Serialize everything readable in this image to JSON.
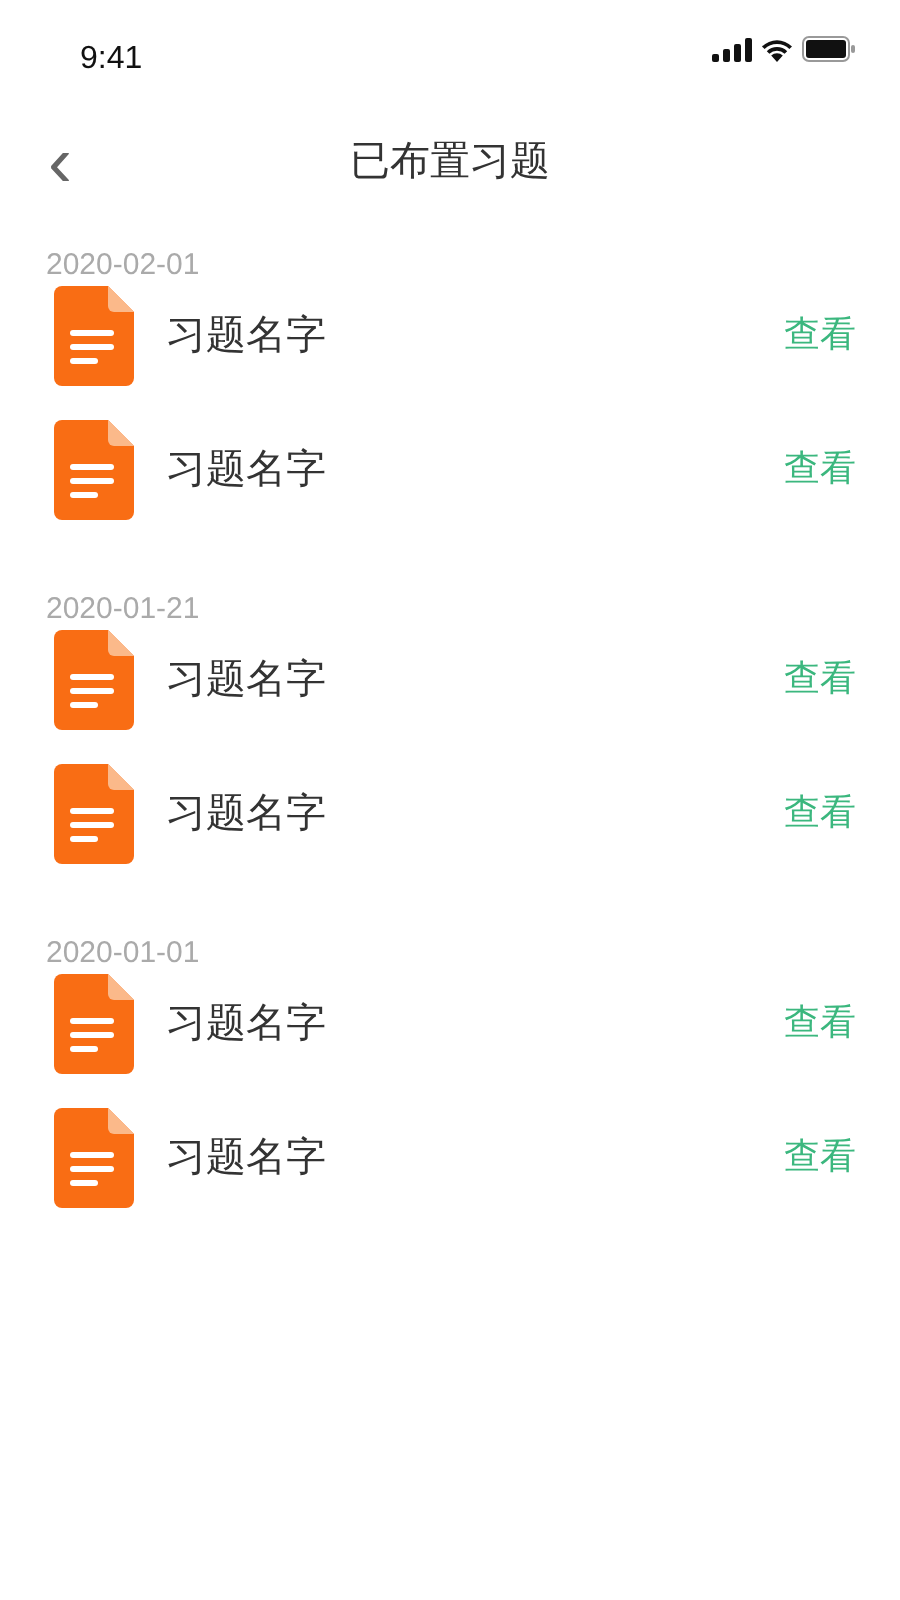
{
  "status_bar": {
    "time": "9:41"
  },
  "nav": {
    "back": "‹",
    "title": "已布置习题"
  },
  "groups": [
    {
      "date": "2020-02-01",
      "items": [
        {
          "name": "习题名字",
          "action": "查看"
        },
        {
          "name": "习题名字",
          "action": "查看"
        }
      ]
    },
    {
      "date": "2020-01-21",
      "items": [
        {
          "name": "习题名字",
          "action": "查看"
        },
        {
          "name": "习题名字",
          "action": "查看"
        }
      ]
    },
    {
      "date": "2020-01-01",
      "items": [
        {
          "name": "习题名字",
          "action": "查看"
        },
        {
          "name": "习题名字",
          "action": "查看"
        }
      ]
    }
  ]
}
